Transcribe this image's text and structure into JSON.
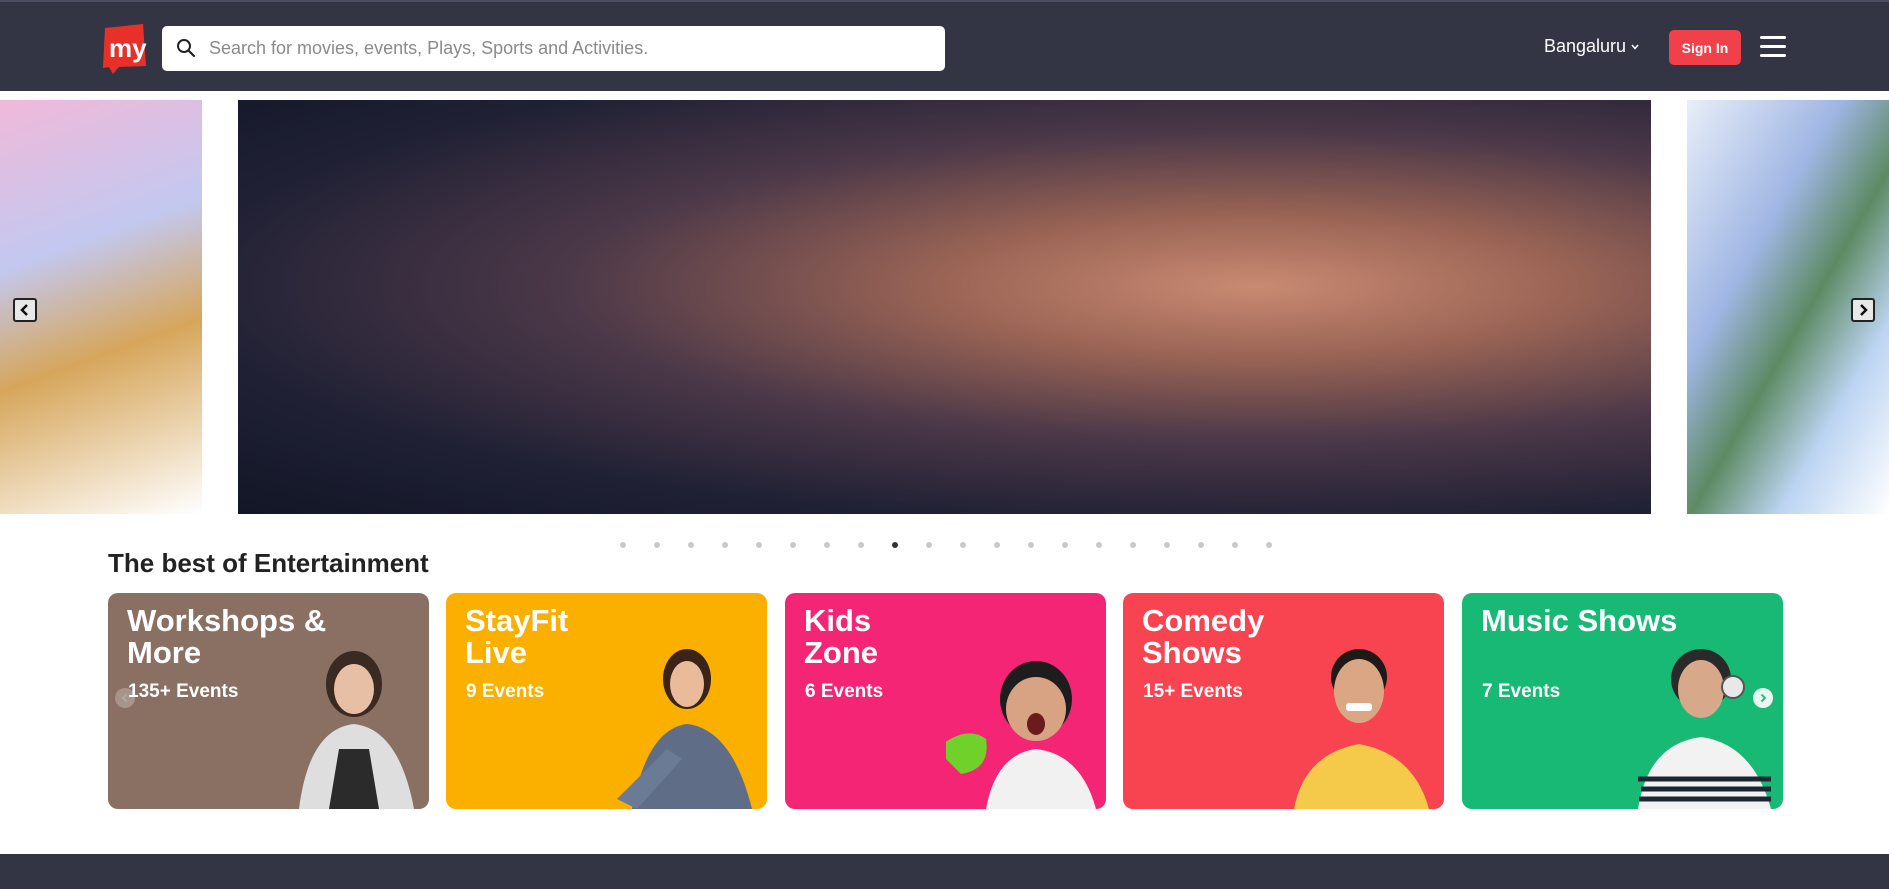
{
  "header": {
    "logo_text": "my",
    "search": {
      "placeholder": "Search for movies, events, Plays, Sports and Activities."
    },
    "city": "Bangaluru",
    "signin_label": "Sign In"
  },
  "carousel": {
    "dot_count": 20,
    "active_index": 8
  },
  "section": {
    "title": "The best of Entertainment",
    "cards": [
      {
        "title": "Workshops & More",
        "count": "135+ Events",
        "color": "#8a7063"
      },
      {
        "title": "StayFit Live",
        "count": "9 Events",
        "color": "#fbb000"
      },
      {
        "title": "Kids Zone",
        "count": "6 Events",
        "color": "#f42575"
      },
      {
        "title": "Comedy Shows",
        "count": "15+ Events",
        "color": "#f84450"
      },
      {
        "title": "Music Shows",
        "count": "7 Events",
        "color": "#17b975"
      }
    ]
  },
  "colors": {
    "header_bg": "#333545",
    "brand_red": "#f0404a"
  }
}
